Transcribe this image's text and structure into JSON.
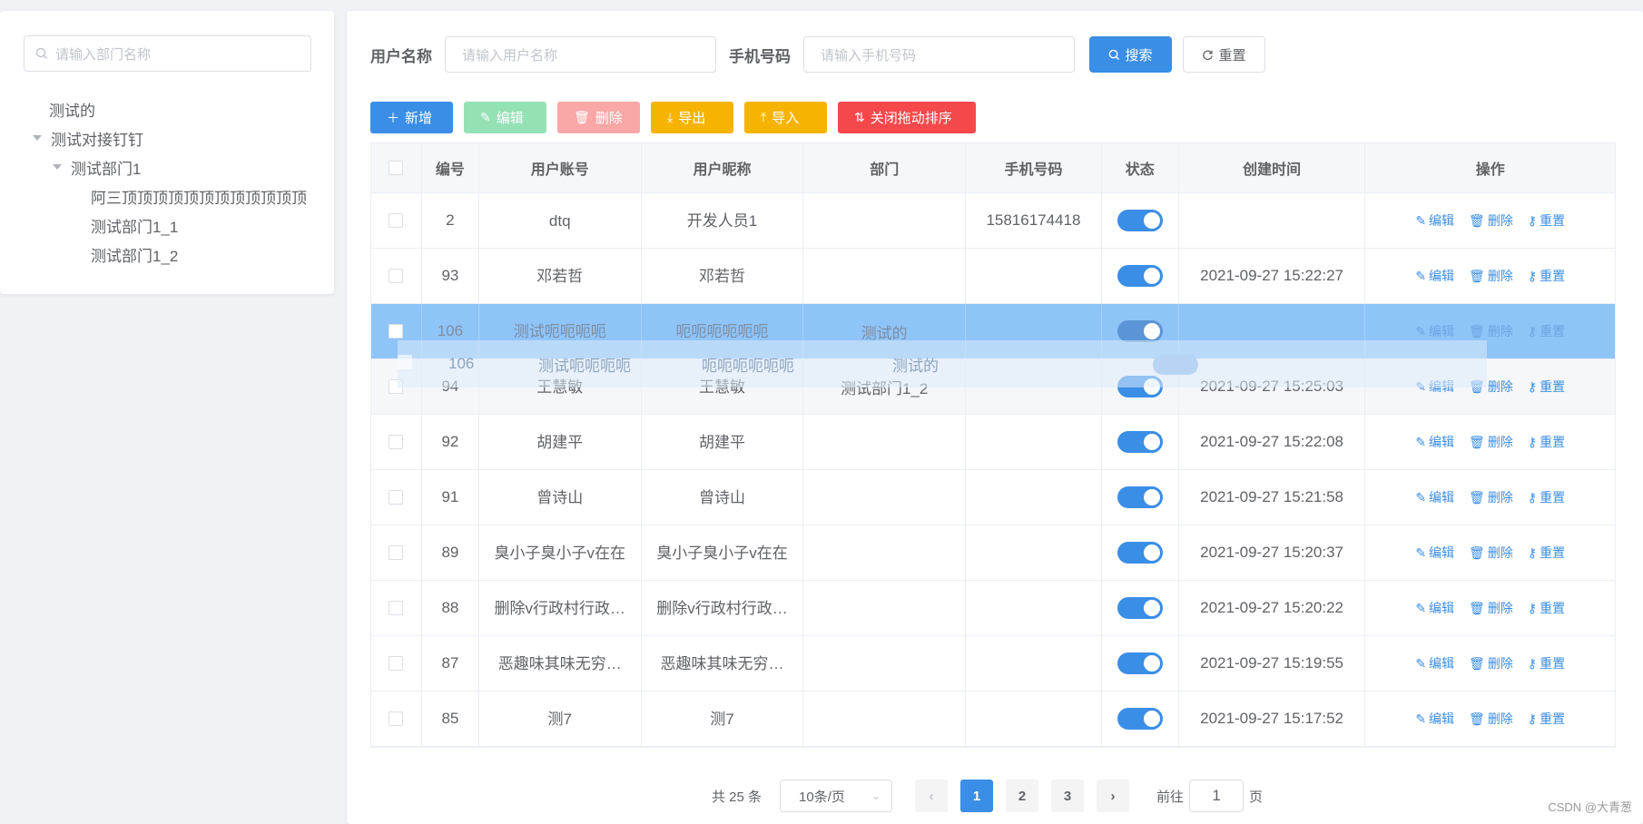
{
  "sidebar": {
    "search_placeholder": "请输入部门名称",
    "tree": [
      {
        "label": "测试的"
      },
      {
        "label": "测试对接钉钉"
      },
      {
        "label": "测试部门1"
      },
      {
        "label": "阿三顶顶顶顶顶顶顶顶顶顶顶顶"
      },
      {
        "label": "测试部门1_1"
      },
      {
        "label": "测试部门1_2"
      }
    ]
  },
  "search": {
    "username_label": "用户名称",
    "username_placeholder": "请输入用户名称",
    "phone_label": "手机号码",
    "phone_placeholder": "请输入手机号码",
    "search_btn": "搜索",
    "reset_btn": "重置"
  },
  "toolbar": {
    "add": "新增",
    "edit": "编辑",
    "delete": "删除",
    "export": "导出",
    "import": "导入",
    "drag": "关闭拖动排序"
  },
  "table": {
    "headers": [
      "编号",
      "用户账号",
      "用户昵称",
      "部门",
      "手机号码",
      "状态",
      "创建时间",
      "操作"
    ],
    "rows": [
      {
        "id": "2",
        "account": "dtq",
        "nickname": "开发人员1",
        "dept": "",
        "phone": "15816174418",
        "time": ""
      },
      {
        "id": "93",
        "account": "邓若哲",
        "nickname": "邓若哲",
        "dept": "",
        "phone": "",
        "time": "2021-09-27 15:22:27"
      },
      {
        "id": "106",
        "account": "测试呃呃呃呃",
        "nickname": "呃呃呃呃呃呃",
        "dept": "测试的",
        "phone": "",
        "time": ""
      },
      {
        "id": "94",
        "account": "王慧敏",
        "nickname": "王慧敏",
        "dept": "测试部门1_2",
        "phone": "",
        "time": "2021-09-27 15:25:03"
      },
      {
        "id": "92",
        "account": "胡建平",
        "nickname": "胡建平",
        "dept": "",
        "phone": "",
        "time": "2021-09-27 15:22:08"
      },
      {
        "id": "91",
        "account": "曾诗山",
        "nickname": "曾诗山",
        "dept": "",
        "phone": "",
        "time": "2021-09-27 15:21:58"
      },
      {
        "id": "89",
        "account": "臭小子臭小子v在在",
        "nickname": "臭小子臭小子v在在",
        "dept": "",
        "phone": "",
        "time": "2021-09-27 15:20:37"
      },
      {
        "id": "88",
        "account": "删除v行政村行政…",
        "nickname": "删除v行政村行政…",
        "dept": "",
        "phone": "",
        "time": "2021-09-27 15:20:22"
      },
      {
        "id": "87",
        "account": "恶趣味其味无穷…",
        "nickname": "恶趣味其味无穷…",
        "dept": "",
        "phone": "",
        "time": "2021-09-27 15:19:55"
      },
      {
        "id": "85",
        "account": "测7",
        "nickname": "测7",
        "dept": "",
        "phone": "",
        "time": "2021-09-27 15:17:52"
      }
    ],
    "ops": {
      "edit": "编辑",
      "delete": "删除",
      "reset": "重置"
    }
  },
  "drag_ghost": {
    "id": "106",
    "account": "测试呃呃呃呃",
    "nickname": "呃呃呃呃呃呃",
    "dept": "测试的"
  },
  "pagination": {
    "total": "共 25 条",
    "page_size": "10条/页",
    "pages": [
      "1",
      "2",
      "3"
    ],
    "current": "1",
    "goto_prefix": "前往",
    "goto_value": "1",
    "goto_suffix": "页"
  },
  "watermark": "CSDN @大青葱"
}
